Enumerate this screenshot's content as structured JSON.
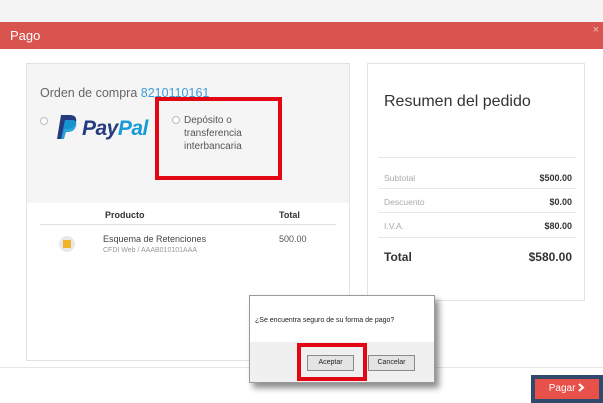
{
  "modal": {
    "title": "Pago",
    "close_label": "×"
  },
  "order": {
    "label": "Orden de compra",
    "number": "8210110161"
  },
  "payment_methods": {
    "paypal": {
      "logo_text_1": "Pay",
      "logo_text_2": "Pal"
    },
    "deposit": {
      "label": "Depósito o transferencia interbancaria"
    }
  },
  "product_table": {
    "headers": [
      "Producto",
      "Total"
    ],
    "rows": [
      {
        "name": "Esquema de Retenciones",
        "subtitle": "CFDI Web / AAAB010101AAA",
        "total": "500.00"
      }
    ]
  },
  "summary": {
    "title": "Resumen del pedido",
    "subtotal_label": "Subtotal",
    "subtotal_value": "$500.00",
    "discount_label": "Descuento",
    "discount_value": "$0.00",
    "tax_label": "I.V.A.",
    "tax_value": "$80.00",
    "total_label": "Total",
    "total_value": "$580.00"
  },
  "confirm_dialog": {
    "message": "¿Se encuentra seguro de su forma de pago?",
    "accept_label": "Aceptar",
    "cancel_label": "Cancelar"
  },
  "pay_button": {
    "label": "Pagar",
    "icon": "chevron-right-icon"
  },
  "colors": {
    "header": "#d9534f",
    "highlight": "#e30613",
    "link": "#3b9dd8",
    "pay_button": "#e8504a"
  }
}
